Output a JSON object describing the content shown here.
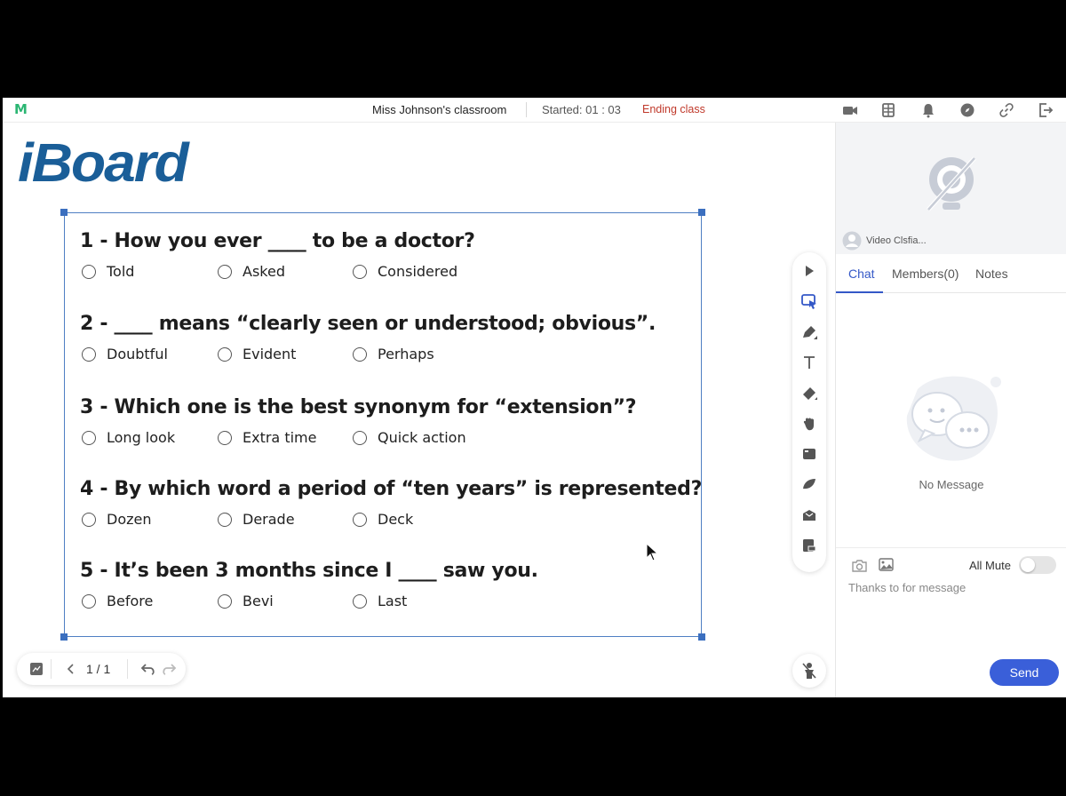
{
  "header": {
    "logo": "M",
    "class_title": "Miss Johnson's classroom",
    "started": "Started: 01 : 03",
    "ending_class": "Ending class",
    "icons": [
      "camera-icon",
      "layout-icon",
      "bell-icon",
      "compass-icon",
      "link-icon",
      "exit-icon"
    ]
  },
  "board": {
    "brand": "iBoard",
    "questions": [
      {
        "text": "1 - How you ever ____ to be a doctor?",
        "options": [
          "Told",
          "Asked",
          "Considered"
        ]
      },
      {
        "text": "2 - ____ means “clearly seen or understood; obvious”.",
        "options": [
          "Doubtful",
          "Evident",
          "Perhaps"
        ]
      },
      {
        "text": "3 - Which one is the best synonym for “extension”?",
        "options": [
          "Long look",
          "Extra time",
          "Quick action"
        ]
      },
      {
        "text": "4 - By which word a period of “ten years” is represented?",
        "options": [
          "Dozen",
          "Derade",
          "Deck"
        ]
      },
      {
        "text": "5 - It’s been 3 months since I ____ saw you.",
        "options": [
          "Before",
          "Bevi",
          "Last"
        ]
      }
    ],
    "tools": [
      "play-icon",
      "select-icon",
      "pen-icon",
      "text-icon",
      "eraser-icon",
      "hand-icon",
      "screen-icon",
      "shape-icon",
      "toolbox-icon",
      "file-icon"
    ],
    "pager": {
      "page": "1 / 1"
    }
  },
  "panel": {
    "video_user": "Video Clsfia...",
    "tabs": {
      "chat": "Chat",
      "members": "Members(0)",
      "notes": "Notes"
    },
    "no_message": "No Message",
    "all_mute": "All Mute",
    "chat_input": "Thanks to for message",
    "send": "Send",
    "colors": {
      "accent": "#3a5fd9",
      "brand": "#1a5e98",
      "ending": "#c0392b"
    }
  }
}
